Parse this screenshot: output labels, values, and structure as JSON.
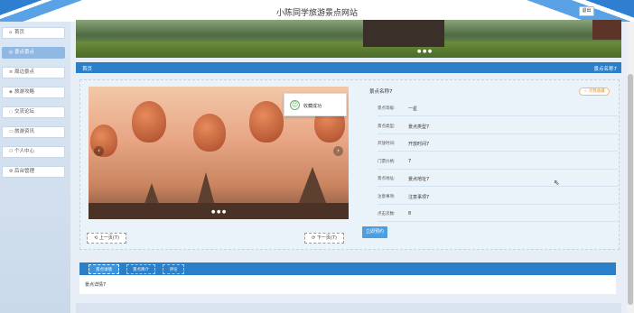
{
  "header": {
    "title": "小陈同学旅游景点网站",
    "logout_label": "退出"
  },
  "sidebar": {
    "items": [
      {
        "label": "首页",
        "icon": "home-icon",
        "glyph": "⌂"
      },
      {
        "label": "景点景点",
        "icon": "location-icon",
        "glyph": "◎"
      },
      {
        "label": "周边景点",
        "icon": "list-icon",
        "glyph": "≡"
      },
      {
        "label": "旅游攻略",
        "icon": "book-icon",
        "glyph": "◈"
      },
      {
        "label": "交流论坛",
        "icon": "chat-icon",
        "glyph": "◌"
      },
      {
        "label": "旅游资讯",
        "icon": "news-icon",
        "glyph": "▭"
      },
      {
        "label": "个人中心",
        "icon": "user-icon",
        "glyph": "⚇"
      },
      {
        "label": "后台管理",
        "icon": "link-icon",
        "glyph": "⚙"
      }
    ],
    "active_index": 1
  },
  "breadcrumb": {
    "home": "首页",
    "current": "景点名称7"
  },
  "detail": {
    "title": "景点名称7",
    "collect_label": "☆ 点我收藏",
    "toast": "收藏成功",
    "pager": "● ● ●",
    "prev_label": "⟲ 上一页(7)",
    "next_label": "⟳ 下一页(7)",
    "book_label": "立即预约",
    "rows": [
      {
        "label": "景点等级:",
        "value": "一星"
      },
      {
        "label": "景点类型:",
        "value": "景点类型7"
      },
      {
        "label": "开放时间:",
        "value": "开放时间7"
      },
      {
        "label": "门票价格:",
        "value": "7"
      },
      {
        "label": "景点地址:",
        "value": "景点地址7"
      },
      {
        "label": "注意事项:",
        "value": "注意事项7"
      },
      {
        "label": "点击次数:",
        "value": "8"
      }
    ]
  },
  "tabs": {
    "items": [
      "景点详情",
      "景点简介",
      "评论"
    ],
    "active_index": 0,
    "content": "景点详情7"
  },
  "banner": {
    "pager": "● ● ●"
  },
  "colors": {
    "primary": "#2a7fc8",
    "accent": "#4a9fe4",
    "sidebar_active": "#8fb8e3"
  }
}
